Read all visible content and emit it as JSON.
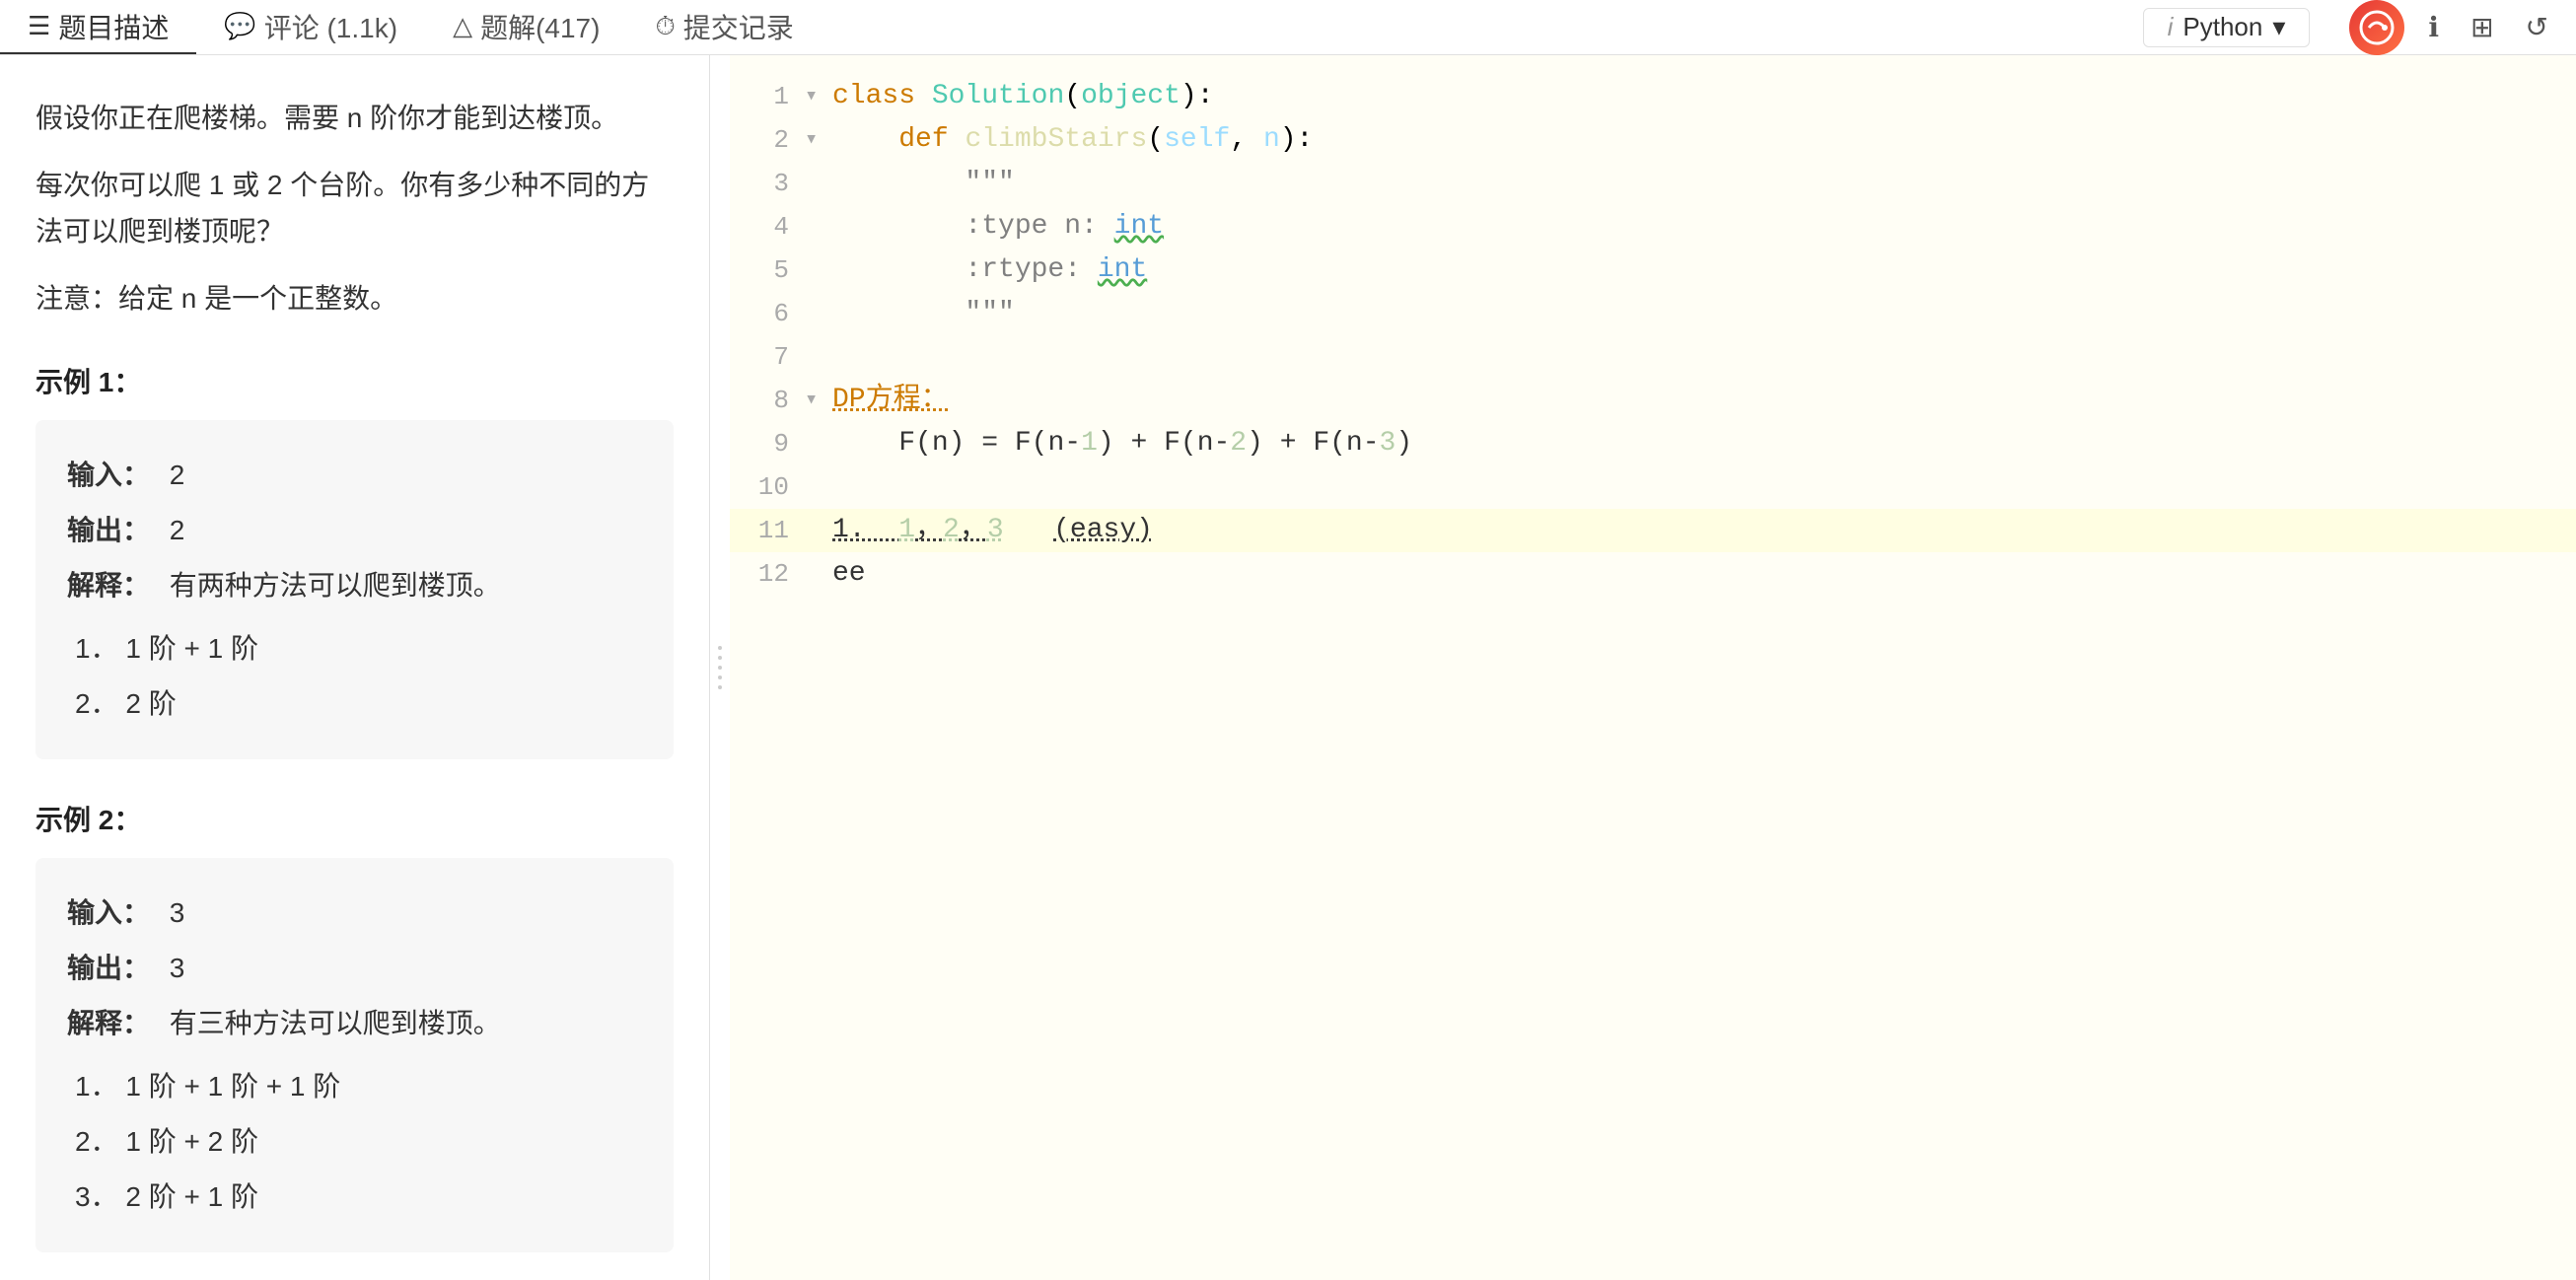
{
  "nav": {
    "tabs": [
      {
        "id": "problem",
        "icon": "☰",
        "label": "题目描述",
        "active": true
      },
      {
        "id": "comments",
        "icon": "💬",
        "label": "评论 (1.1k)",
        "active": false
      },
      {
        "id": "solutions",
        "icon": "△",
        "label": "题解(417)",
        "active": false
      },
      {
        "id": "submissions",
        "icon": "⏱",
        "label": "提交记录",
        "active": false
      }
    ],
    "lang": {
      "i_label": "i",
      "lang_label": "Python",
      "arrow": "▾"
    },
    "icons": {
      "info": "ℹ",
      "layout": "⊞",
      "undo": "↺"
    }
  },
  "problem": {
    "intro1": "假设你正在爬楼梯。需要 n 阶你才能到达楼顶。",
    "intro2": "每次你可以爬 1 或 2 个台阶。你有多少种不同的方法可以爬到楼顶呢？",
    "note": "注意：给定 n 是一个正整数。",
    "example1": {
      "title": "示例 1：",
      "input_label": "输入：",
      "input_val": "2",
      "output_label": "输出：",
      "output_val": "2",
      "explain_label": "解释：",
      "explain_val": "有两种方法可以爬到楼顶。",
      "steps": [
        "1．  1 阶 + 1 阶",
        "2．  2 阶"
      ]
    },
    "example2": {
      "title": "示例 2：",
      "input_label": "输入：",
      "input_val": "3",
      "output_label": "输出：",
      "output_val": "3",
      "explain_label": "解释：",
      "explain_val": "有三种方法可以爬到楼顶。",
      "steps": [
        "1．  1 阶 + 1 阶 + 1 阶",
        "2．  1 阶 + 2 阶",
        "3．  2 阶 + 1 阶"
      ]
    }
  },
  "editor": {
    "lines": [
      {
        "num": 1,
        "toggle": "▾",
        "content": "class Solution(object):",
        "type": "class_def"
      },
      {
        "num": 2,
        "toggle": "▾",
        "content": "    def climbStairs(self, n):",
        "type": "method_def"
      },
      {
        "num": 3,
        "toggle": "",
        "content": "        \"\"\"",
        "type": "docstring"
      },
      {
        "num": 4,
        "toggle": "",
        "content": "        :type n: int",
        "type": "docstring"
      },
      {
        "num": 5,
        "toggle": "",
        "content": "        :rtype: int",
        "type": "docstring"
      },
      {
        "num": 6,
        "toggle": "",
        "content": "        \"\"\"",
        "type": "docstring"
      },
      {
        "num": 7,
        "toggle": "",
        "content": "",
        "type": "empty"
      },
      {
        "num": 8,
        "toggle": "▾",
        "content": "DP方程：",
        "type": "comment_dp"
      },
      {
        "num": 9,
        "toggle": "",
        "content": "    F(n) = F(n-1) + F(n-2) + F(n-3)",
        "type": "dp_formula"
      },
      {
        "num": 10,
        "toggle": "",
        "content": "",
        "type": "empty"
      },
      {
        "num": 11,
        "toggle": "",
        "content": "1.  1，2，3   (easy)",
        "type": "comment_note",
        "highlighted": true
      },
      {
        "num": 12,
        "toggle": "",
        "content": "ee",
        "type": "code_plain"
      }
    ]
  }
}
